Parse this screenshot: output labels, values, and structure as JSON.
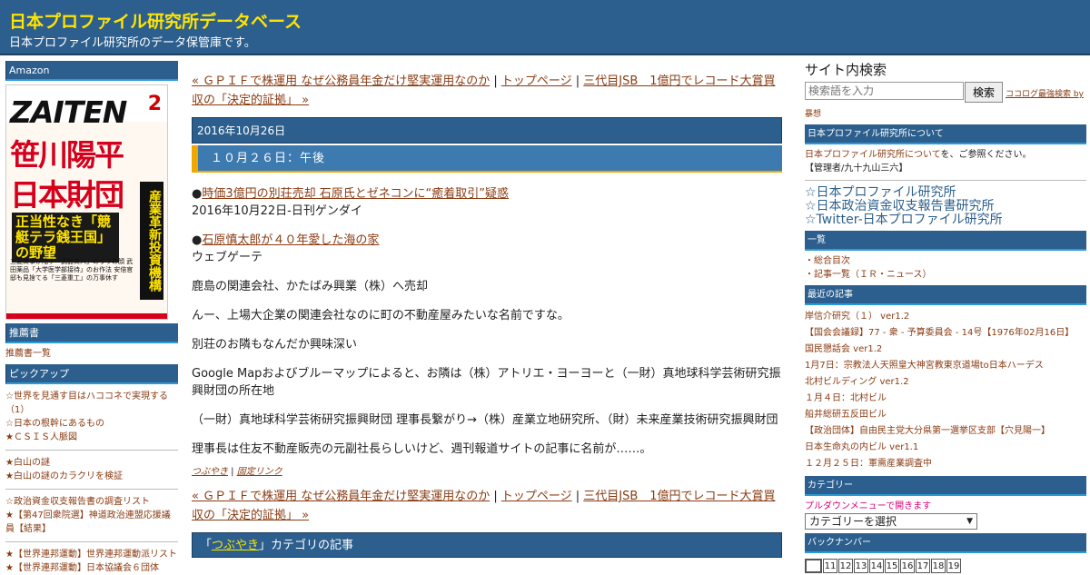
{
  "header": {
    "title": "日本プロファイル研究所データベース",
    "description": "日本プロファイル研究所のデータ保管庫です。"
  },
  "left": {
    "amazon_heading": "Amazon",
    "magazine": {
      "logo": "ZAITEN",
      "issue": "2",
      "headline1": "笹川陽平",
      "headline2": "日本財団",
      "sub": "正当性なき「競艇テラ銭王国」の野望",
      "side": "産業革新投資機構",
      "body": "三菱商事が陥す「武器商人」のウラの顔 武田薬品「大学医学部接待」のお作法 安倍官邸も見捨てる「三菱重工」の万事休す"
    },
    "recommend_heading": "推薦書",
    "recommend_link": "推薦書一覧",
    "pickup_heading": "ピックアップ",
    "pickup_group1": [
      "☆世界を見通す目はハココネで実現する（1）",
      "☆日本の根幹にあるもの",
      "★ＣＳＩＳ人脈図"
    ],
    "pickup_group2": [
      "★白山の謎",
      "★白山の謎のカラクリを検証"
    ],
    "pickup_group3": [
      "☆政治資金収支報告書の調査リスト",
      "★【第47回衆院選】神道政治連盟応援議員【結果】"
    ],
    "pickup_group4": [
      "★【世界連邦運動】世界連邦運動派リスト",
      "★【世界連邦運動】日本協議会６団体"
    ]
  },
  "main": {
    "nav_prev": "« ＧＰＩＦで株運用 なぜ公務員年金だけ堅実運用なのか",
    "nav_sep1": " | ",
    "nav_top": "トップページ",
    "nav_sep2": " | ",
    "nav_next": "三代目JSB　1億円でレコード大賞買収の「決定的証拠」 »",
    "date": "2016年10月26日",
    "post_title": "１０月２６日：午後",
    "item1_bullet": "●",
    "item1_link": "時価3億円の別荘売却 石原氏とゼネコンに“癒着取引”疑惑",
    "item1_source": "2016年10月22日-日刊ゲンダイ",
    "item2_bullet": "●",
    "item2_link": "石原慎太郎が４０年愛した海の家",
    "item2_source": "ウェブゲーテ",
    "para1": "鹿島の関連会社、かたばみ興業（株）へ売却",
    "para2": "んー、上場大企業の関連会社なのに町の不動産屋みたいな名前ですな。",
    "para3": "別荘のお隣もなんだか興味深い",
    "para4": "Google Mapおよびブルーマップによると、お隣は（株）アトリエ・ヨーヨーと（一財）真地球科学芸術研究振興財団の所在地",
    "para5": "（一財）真地球科学芸術研究振興財団 理事長繋がり→（株）産業立地研究所、（財）未来産業技術研究振興財団",
    "para6": "理事長は住友不動産販売の元副社長らしいけど、週刊報道サイトの記事に名前が……。",
    "foot_cat": "つぶやき",
    "foot_sep": " | ",
    "foot_perma": "固定リンク",
    "cat_bar_open": "「",
    "cat_bar_link": "つぶやき",
    "cat_bar_rest": "」カテゴリの記事"
  },
  "right": {
    "search_heading": "サイト内検索",
    "search_placeholder": "検索語を入力",
    "search_button": "検索",
    "search_credit": "ココログ最強検索 by",
    "search_credit2": "暴想",
    "about_heading": "日本プロファイル研究所について",
    "about_link": "日本プロファイル研究所について",
    "about_text": "を、ご参照ください。",
    "admin": "【管理者/九十九山三六】",
    "big_links": [
      "☆日本プロファイル研究所",
      "☆日本政治資金収支報告書研究所",
      "☆Twitter-日本プロファイル研究所"
    ],
    "list_heading": "一覧",
    "list_items": [
      "・総合目次",
      "・記事一覧（ＩＲ・ニュース）"
    ],
    "recent_heading": "最近の記事",
    "recent_items": [
      "岸信介研究（１） ver1.2",
      "【国会会議録】77 - 衆 - 予算委員会 - 14号【1976年02月16日】",
      "国民懇話会 ver1.2",
      "1月7日：宗教法人天照皇大神宮教東京道場to日本ハーデス",
      "北村ビルディング ver1.2",
      "１月４日：北村ビル",
      "船井総研五反田ビル",
      "【政治団体】自由民主党大分県第一選挙区支部【穴見陽一】",
      "日本生命丸の内ビル ver1.1",
      "１２月２５日：軍需産業調査中"
    ],
    "category_heading": "カテゴリー",
    "category_hint": "プルダウンメニューで開きます",
    "category_select": "カテゴリーを選択",
    "backnumber_heading": "バックナンバー",
    "backnumbers": [
      "",
      "11",
      "12",
      "13",
      "14",
      "15",
      "16",
      "17",
      "18",
      "19"
    ]
  }
}
